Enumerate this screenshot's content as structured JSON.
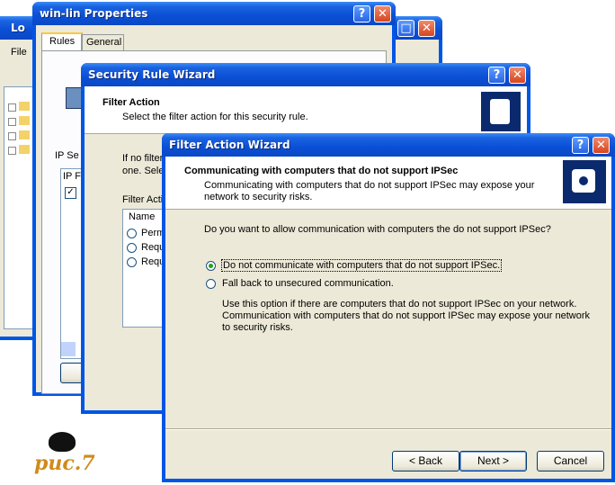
{
  "win_back": {
    "title_fragment": "Lo",
    "menu_file": "File"
  },
  "win_props": {
    "title": "win-lin Properties",
    "tabs": [
      "Rules",
      "General"
    ],
    "ip_sec_label": "IP Se",
    "list_header": "IP F",
    "button_add": "A"
  },
  "win_rule": {
    "title": "Security Rule Wizard",
    "heading": "Filter Action",
    "subtitle": "Select the filter action for this security rule.",
    "body_line1": "If no filter",
    "body_line2": "one. Sele",
    "filter_action_label": "Filter Actio",
    "list_header": "Name",
    "items": [
      "Perm",
      "Requ",
      "Requ"
    ]
  },
  "win_wizard": {
    "title": "Filter Action Wizard",
    "heading": "Communicating with computers that do not support IPSec",
    "subtitle_line1": "Communicating with computers that do not support IPSec may expose your",
    "subtitle_line2": "network to security risks.",
    "question": "Do you want to allow communication with computers the do not support IPSec?",
    "option1": "Do not communicate with computers that do not support IPSec.",
    "option2": "Fall back to unsecured communication.",
    "desc_line1": "Use this option if there are computers that do not support IPSec on your network.",
    "desc_line2": "Communication with computers that do not support IPSec may expose your network",
    "desc_line3": "to security risks.",
    "back": "< Back",
    "next": "Next >",
    "cancel": "Cancel"
  },
  "help_glyph": "?",
  "close_glyph": "✕",
  "caption": "рис.7"
}
